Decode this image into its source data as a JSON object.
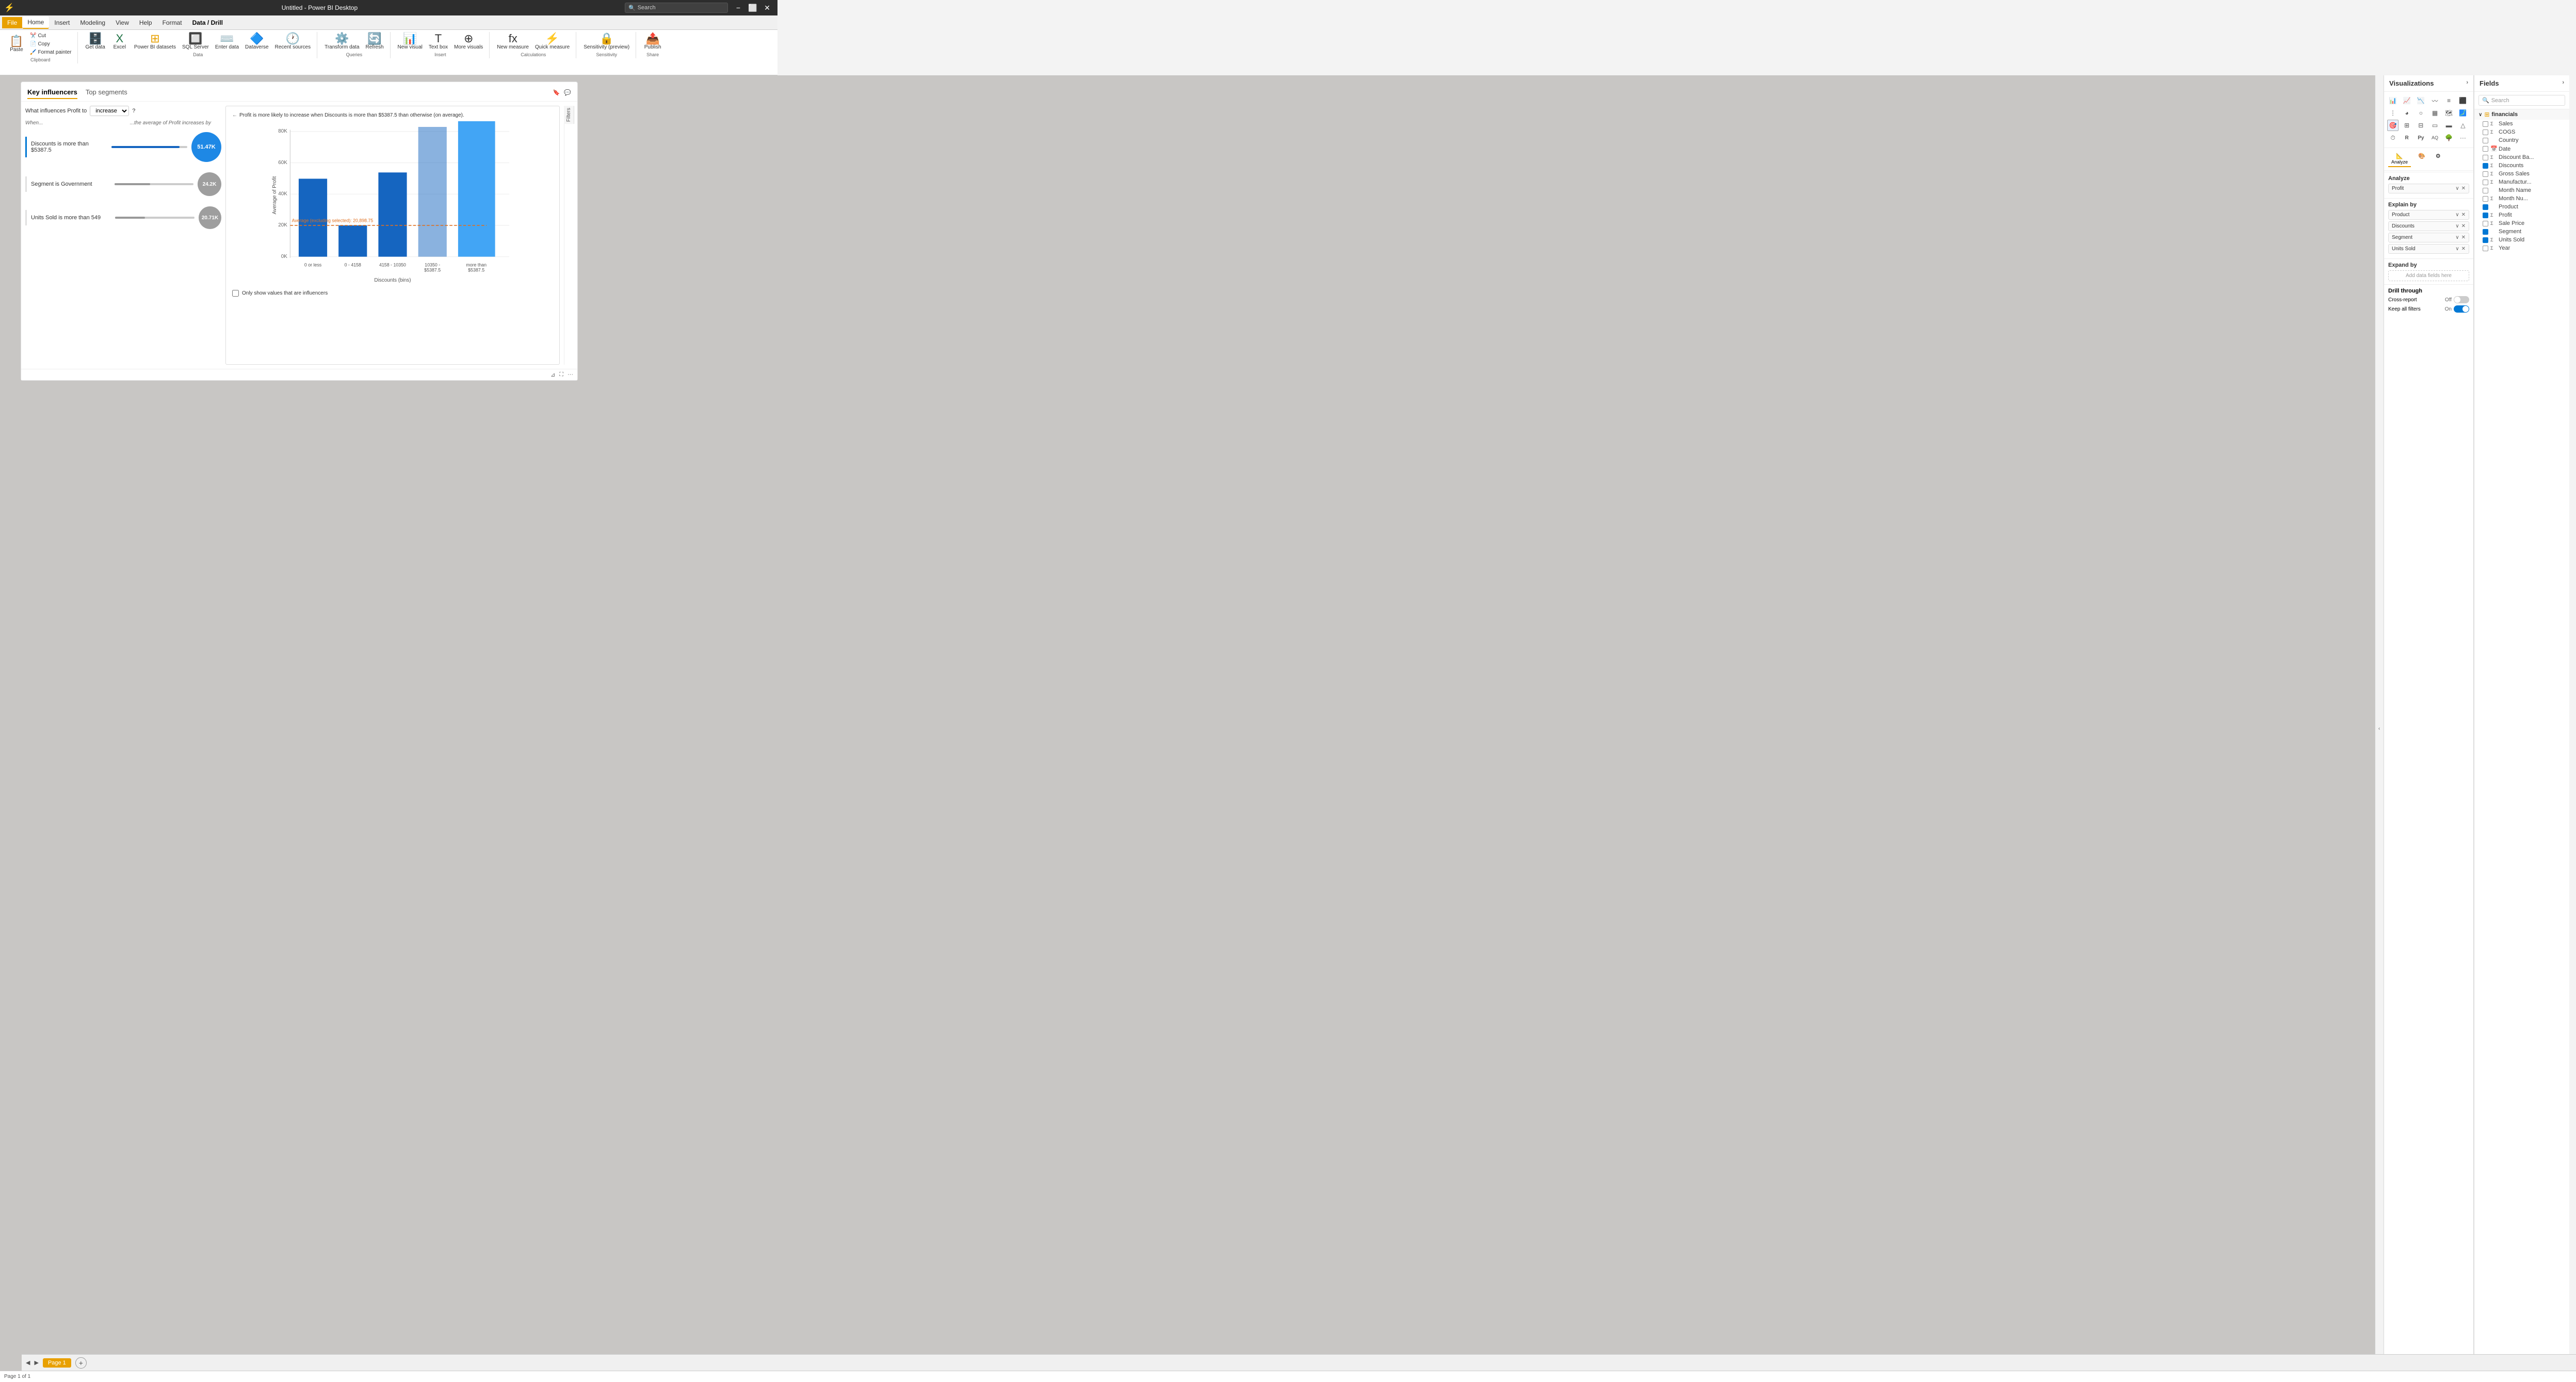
{
  "titlebar": {
    "title": "Untitled - Power BI Desktop",
    "search_placeholder": "Search",
    "btn_minimize": "−",
    "btn_restore": "⬜",
    "btn_close": "✕"
  },
  "menubar": {
    "file": "File",
    "home": "Home",
    "insert": "Insert",
    "modeling": "Modeling",
    "view": "View",
    "help": "Help",
    "format": "Format",
    "data_drill": "Data / Drill"
  },
  "ribbon": {
    "clipboard_group": "Clipboard",
    "paste": "Paste",
    "cut": "Cut",
    "copy": "Copy",
    "format_painter": "Format painter",
    "data_group": "Data",
    "get_data": "Get data",
    "excel": "Excel",
    "power_bi_datasets": "Power BI datasets",
    "sql_server": "SQL Server",
    "enter_data": "Enter data",
    "dataverse": "Dataverse",
    "recent_sources": "Recent sources",
    "queries_group": "Queries",
    "transform_data": "Transform data",
    "refresh": "Refresh",
    "insert_group": "Insert",
    "new_visual": "New visual",
    "text_box": "Text box",
    "more_visuals": "More visuals",
    "calculations_group": "Calculations",
    "new_measure": "New measure",
    "quick_measure": "Quick measure",
    "sensitivity_group": "Sensitivity",
    "sensitivity": "Sensitivity (preview)",
    "share_group": "Share",
    "publish": "Publish"
  },
  "visual": {
    "tab_key_influencers": "Key influencers",
    "tab_top_segments": "Top segments",
    "question_label": "What influences Profit to",
    "dropdown_value": "increase",
    "question_mark": "?",
    "when_header": "When...",
    "increases_header": "...the average of Profit increases by",
    "influencers": [
      {
        "label": "Discounts is more than $5387.5",
        "value": "51.47K",
        "bar_width": "90",
        "is_large": true,
        "color": "blue"
      },
      {
        "label": "Segment is Government",
        "value": "24.2K",
        "bar_width": "45",
        "is_large": false,
        "color": "gray"
      },
      {
        "label": "Units Sold is more than 549",
        "value": "20.71K",
        "bar_width": "38",
        "is_large": false,
        "color": "gray"
      }
    ],
    "chart_back_label": "←",
    "chart_description": "Profit is more likely to increase when Discounts is more than $5387.5 than otherwise (on average).",
    "chart_y_label": "Average of Profit",
    "chart_x_label": "Discounts (bins)",
    "chart_avg_label": "Average (excluding selected): 20,898.75",
    "chart_y_ticks": [
      "80K",
      "60K",
      "40K",
      "20K",
      "0K"
    ],
    "chart_x_bins": [
      "0 or less",
      "0 - 4158",
      "4158 - 10350",
      "10350 - $5387.5",
      "more than $5387.5"
    ],
    "checkbox_label": "Only show values that are influencers",
    "filters_label": "Filters"
  },
  "visualizations": {
    "panel_title": "Visualizations",
    "analyze_label": "Analyze",
    "profit_field": "Profit",
    "explain_by_label": "Explain by",
    "explain_fields": [
      "Product",
      "Discounts",
      "Segment",
      "Units Sold"
    ],
    "expand_by_label": "Expand by",
    "add_fields_placeholder": "Add data fields here",
    "drill_through_label": "Drill through",
    "cross_report_label": "Cross-report",
    "cross_report_off": "Off",
    "keep_all_filters_label": "Keep all filters",
    "keep_all_filters_on": "On"
  },
  "fields": {
    "panel_title": "Fields",
    "search_placeholder": "Search",
    "collapse_icon": "‹",
    "expand_icon": "›",
    "table_name": "financials",
    "expand_arrow": "∨",
    "items": [
      {
        "name": "Sales",
        "checked": false,
        "type": "Σ"
      },
      {
        "name": "COGS",
        "checked": false,
        "type": "Σ"
      },
      {
        "name": "Country",
        "checked": false,
        "type": ""
      },
      {
        "name": "Date",
        "checked": false,
        "type": "📅",
        "is_date": true
      },
      {
        "name": "Discount Ba...",
        "checked": false,
        "type": "Σ"
      },
      {
        "name": "Discounts",
        "checked": true,
        "type": "Σ"
      },
      {
        "name": "Gross Sales",
        "checked": false,
        "type": "Σ"
      },
      {
        "name": "Manufactur...",
        "checked": false,
        "type": "Σ"
      },
      {
        "name": "Month Name",
        "checked": false,
        "type": ""
      },
      {
        "name": "Month Nu...",
        "checked": false,
        "type": "Σ"
      },
      {
        "name": "Product",
        "checked": true,
        "type": ""
      },
      {
        "name": "Profit",
        "checked": true,
        "type": "Σ"
      },
      {
        "name": "Sale Price",
        "checked": false,
        "type": "Σ"
      },
      {
        "name": "Segment",
        "checked": true,
        "type": ""
      },
      {
        "name": "Units Sold",
        "checked": true,
        "type": "Σ"
      },
      {
        "name": "Year",
        "checked": false,
        "type": "Σ"
      }
    ]
  },
  "bottom": {
    "page_tab": "Page 1",
    "add_page": "+",
    "prev": "◀",
    "next": "▶",
    "status": "Page 1 of 1"
  }
}
